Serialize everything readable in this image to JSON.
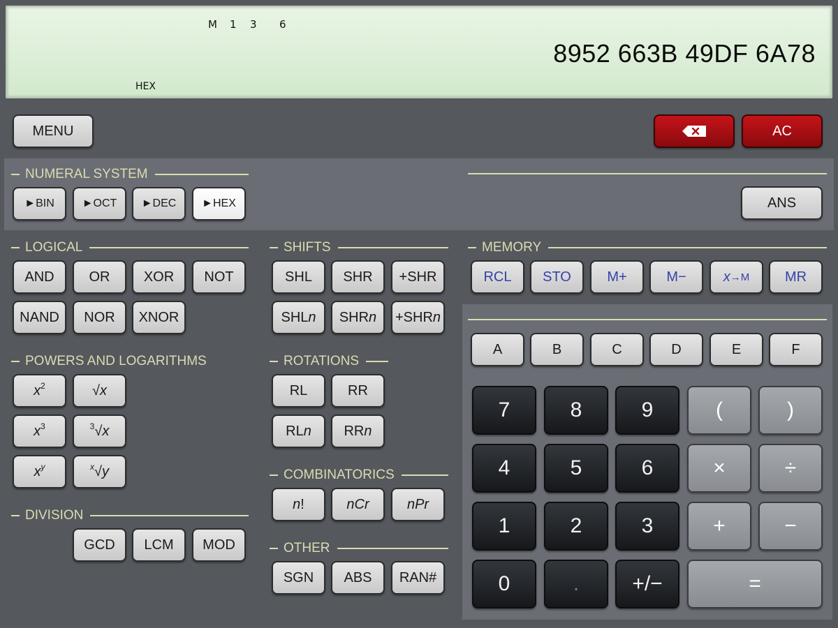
{
  "display": {
    "memory_indicator": "M",
    "digit_indicators": [
      "1",
      "3",
      "6"
    ],
    "mode": "HEX",
    "value": "8952 663B 49DF 6A78"
  },
  "top": {
    "menu": "MENU",
    "ac": "AC",
    "backspace_icon": "backspace-icon"
  },
  "numeral_system": {
    "title": "NUMERAL SYSTEM",
    "buttons": [
      "►BIN",
      "►OCT",
      "►DEC",
      "►HEX"
    ],
    "active": "►HEX",
    "ans": "ANS"
  },
  "logical": {
    "title": "LOGICAL",
    "buttons": [
      "AND",
      "OR",
      "XOR",
      "NOT",
      "NAND",
      "NOR",
      "XNOR"
    ]
  },
  "shifts": {
    "title": "SHIFTS",
    "buttons": [
      "SHL",
      "SHR",
      "+SHR"
    ],
    "suffix": "n"
  },
  "memory": {
    "title": "MEMORY",
    "buttons": [
      "RCL",
      "STO",
      "M+",
      "M−",
      "→M",
      "MR"
    ],
    "x": "x"
  },
  "powers": {
    "title": "POWERS AND LOGARITHMS",
    "x": "x",
    "y": "y",
    "root": "√",
    "sq": "2",
    "cube": "3"
  },
  "rotations": {
    "title": "ROTATIONS",
    "buttons": [
      "RL",
      "RR"
    ],
    "suffix": "n"
  },
  "combinatorics": {
    "title": "COMBINATORICS",
    "n": "n",
    "fact": "!",
    "ncr": "Cr",
    "npr": "Pr"
  },
  "division": {
    "title": "DIVISION",
    "buttons": [
      "GCD",
      "LCM",
      "MOD"
    ]
  },
  "other": {
    "title": "OTHER",
    "buttons": [
      "SGN",
      "ABS",
      "RAN#"
    ]
  },
  "hex_digits": [
    "A",
    "B",
    "C",
    "D",
    "E",
    "F"
  ],
  "keypad": {
    "rows": [
      [
        "7",
        "8",
        "9",
        "(",
        ")"
      ],
      [
        "4",
        "5",
        "6",
        "×",
        "÷"
      ],
      [
        "1",
        "2",
        "3",
        "+",
        "−"
      ]
    ],
    "bottom": [
      "0",
      ".",
      "+/−",
      "="
    ]
  },
  "colors": {
    "background": "#55585d",
    "panel": "#6a6d73",
    "section_text": "#d9ddb0",
    "memory_text": "#3742a8",
    "delete_red": "#b01015"
  }
}
